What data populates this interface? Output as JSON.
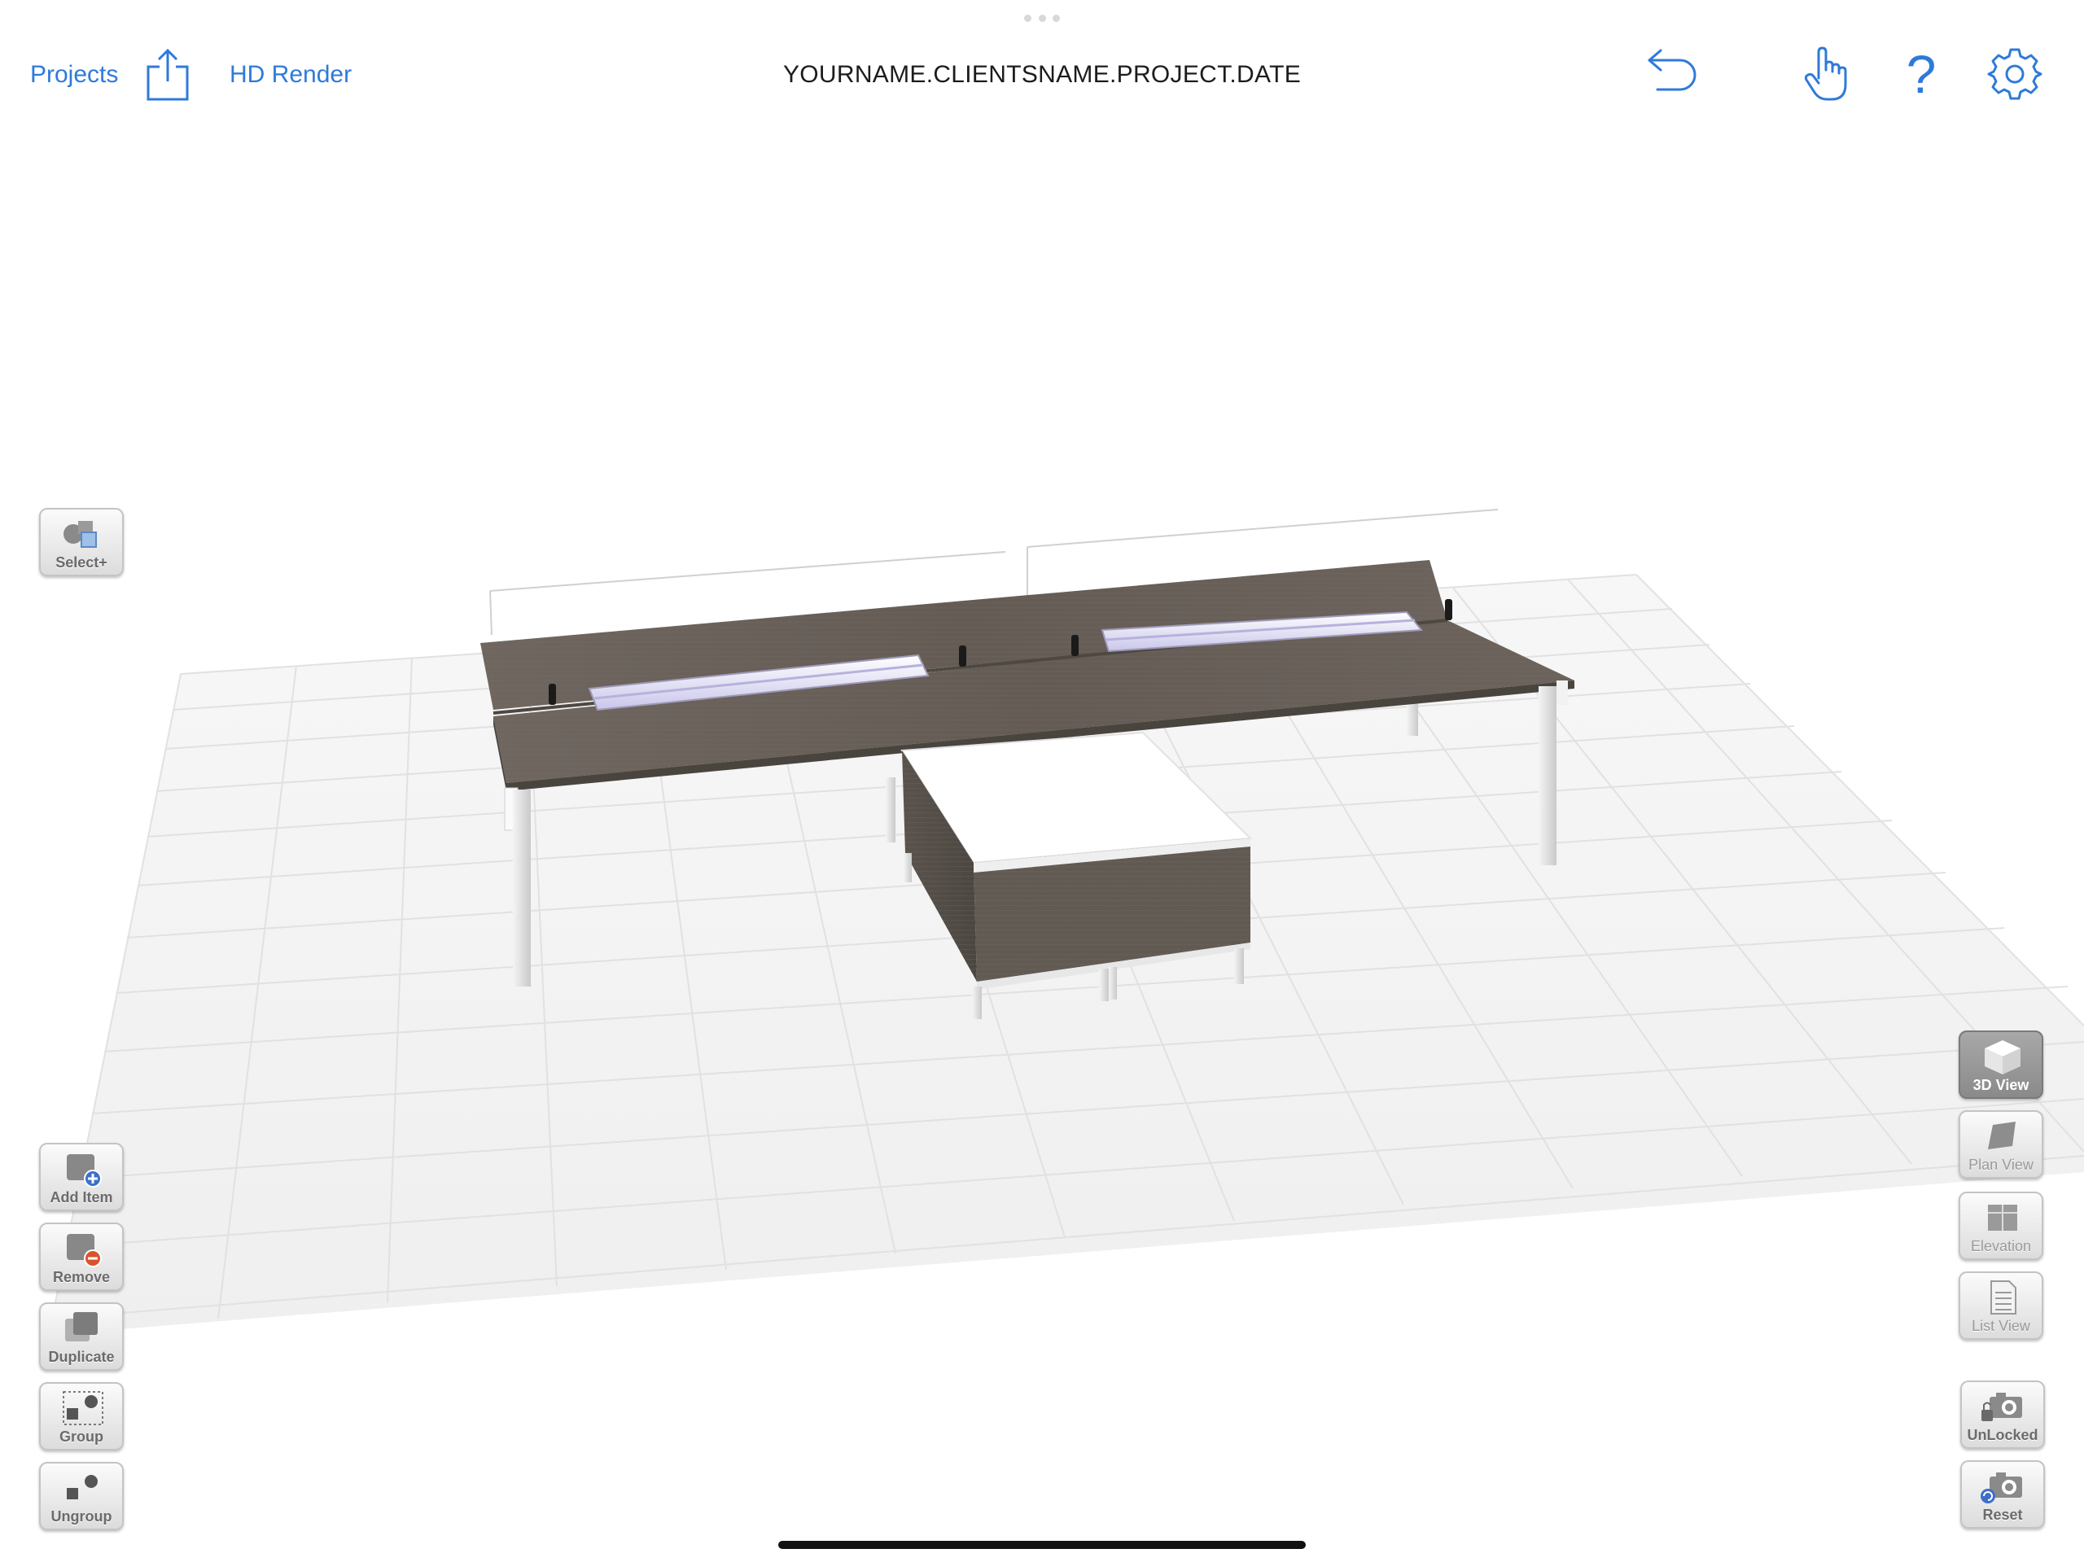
{
  "header": {
    "projects_label": "Projects",
    "share_icon": "share-icon",
    "hd_render_label": "HD Render",
    "title": "YOURNAME.CLIENTSNAME.PROJECT.DATE",
    "undo_icon": "undo-icon",
    "touch_icon": "hand-pointer-icon",
    "help_label": "?",
    "settings_icon": "gear-icon"
  },
  "left_tools": {
    "select_label": "Select+",
    "add_item_label": "Add Item",
    "remove_label": "Remove",
    "duplicate_label": "Duplicate",
    "group_label": "Group",
    "ungroup_label": "Ungroup"
  },
  "view_tools": {
    "view_3d_label": "3D View",
    "plan_view_label": "Plan View",
    "elevation_label": "Elevation",
    "list_view_label": "List View",
    "camera_lock_label": "UnLocked",
    "reset_label": "Reset"
  },
  "colors": {
    "accent": "#2f7ad9",
    "desktop": "#67605a",
    "grid_line": "#dedede",
    "floor": "#f4f4f4"
  }
}
